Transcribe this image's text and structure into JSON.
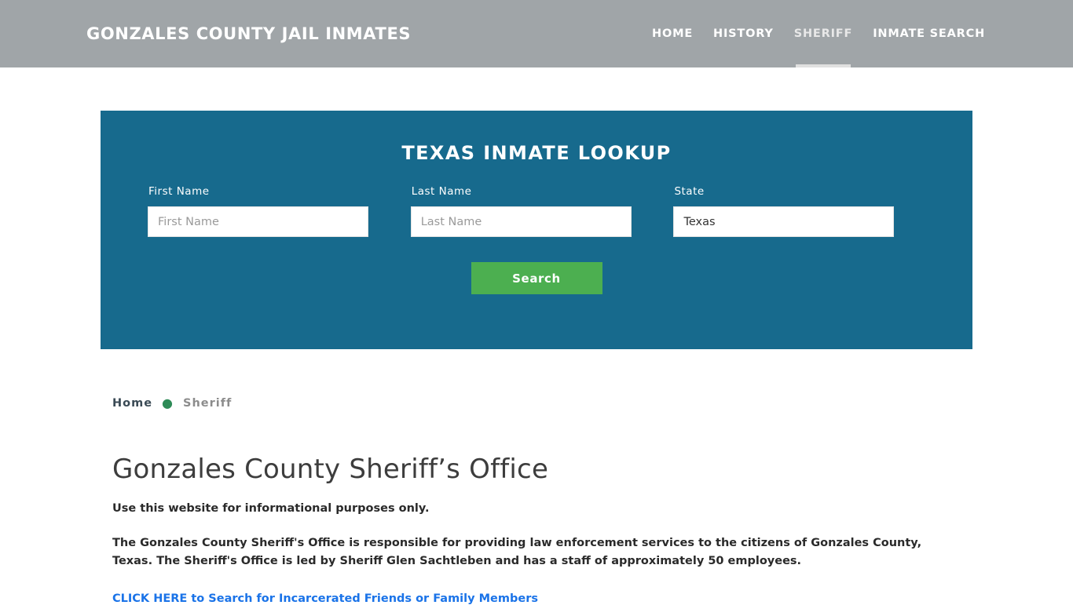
{
  "header": {
    "brand": "Gonzales County Jail Inmates",
    "nav": [
      {
        "label": "HOME",
        "active": false
      },
      {
        "label": "HISTORY",
        "active": false
      },
      {
        "label": "SHERIFF",
        "active": true
      },
      {
        "label": "INMATE SEARCH",
        "active": false
      }
    ]
  },
  "lookup": {
    "title": "Texas Inmate Lookup",
    "first_name_label": "First Name",
    "first_name_placeholder": "First Name",
    "first_name_value": "",
    "last_name_label": "Last Name",
    "last_name_placeholder": "Last Name",
    "last_name_value": "",
    "state_label": "State",
    "state_value": "Texas",
    "search_label": "Search",
    "panel_color": "#176a8d",
    "button_color": "#4caf50"
  },
  "breadcrumb": {
    "home": "Home",
    "separator": "●",
    "current": "Sheriff"
  },
  "main": {
    "title": "Gonzales County Sheriff’s Office",
    "lede": "Use this website for informational purposes only.",
    "paragraph": "The Gonzales County Sheriff's Office is responsible for providing law enforcement services to the citizens of Gonzales County, Texas. The Sheriff's Office is led by Sheriff Glen Sachtleben and has a staff of approximately 50 employees.",
    "cta": "CLICK HERE to Search for Incarcerated Friends or Family Members",
    "cta_color": "#1a73e8"
  }
}
